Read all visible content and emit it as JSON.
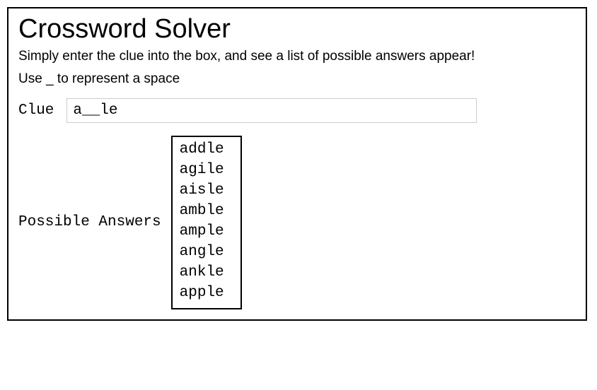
{
  "header": {
    "title": "Crossword Solver",
    "subtitle": "Simply enter the clue into the box, and see a list of possible answers appear!",
    "hint": "Use _ to represent a space"
  },
  "clue": {
    "label": "Clue",
    "value": "a__le"
  },
  "answers": {
    "label": "Possible Answers",
    "items": [
      "addle",
      "agile",
      "aisle",
      "amble",
      "ample",
      "angle",
      "ankle",
      "apple"
    ]
  }
}
